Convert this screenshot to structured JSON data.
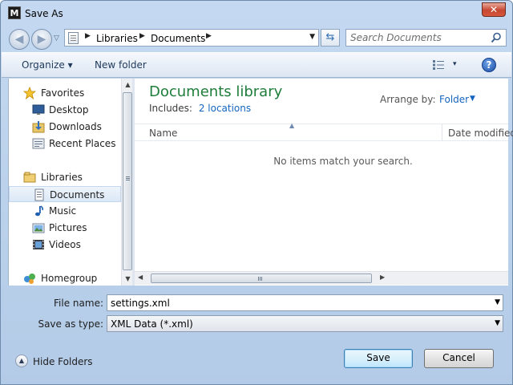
{
  "window": {
    "title": "Save As",
    "app_icon_letter": "M",
    "close_symbol": "✕"
  },
  "navigation": {
    "back_symbol": "◀",
    "forward_symbol": "▶",
    "breadcrumb": [
      "Libraries",
      "Documents"
    ],
    "refresh_symbol": "⇆",
    "search_placeholder": "Search Documents"
  },
  "toolbar": {
    "organize_label": "Organize ▾",
    "new_folder_label": "New folder",
    "view_drop": "▾",
    "help_symbol": "?"
  },
  "nav_pane": {
    "items": [
      {
        "label": "Favorites",
        "icon": "star-icon",
        "indent": 0
      },
      {
        "label": "Desktop",
        "icon": "desktop-icon",
        "indent": 1
      },
      {
        "label": "Downloads",
        "icon": "downloads-icon",
        "indent": 1
      },
      {
        "label": "Recent Places",
        "icon": "recent-places-icon",
        "indent": 1
      },
      {
        "label": "Libraries",
        "icon": "libraries-icon",
        "indent": 0
      },
      {
        "label": "Documents",
        "icon": "documents-icon",
        "indent": 1,
        "selected": true
      },
      {
        "label": "Music",
        "icon": "music-icon",
        "indent": 1
      },
      {
        "label": "Pictures",
        "icon": "pictures-icon",
        "indent": 1
      },
      {
        "label": "Videos",
        "icon": "videos-icon",
        "indent": 1
      },
      {
        "label": "Homegroup",
        "icon": "homegroup-icon",
        "indent": 0
      }
    ]
  },
  "content": {
    "library_title": "Documents library",
    "includes_label": "Includes:",
    "includes_link": "2 locations",
    "arrange_label": "Arrange by:",
    "arrange_value": "Folder",
    "columns": {
      "name": "Name",
      "date_modified": "Date modified"
    },
    "empty_message": "No items match your search."
  },
  "form": {
    "file_name_label": "File name:",
    "file_name_value": "settings.xml",
    "save_type_label": "Save as type:",
    "save_type_value": "XML Data (*.xml)"
  },
  "footer": {
    "hide_folders_label": "Hide Folders",
    "save_label": "Save",
    "cancel_label": "Cancel"
  }
}
